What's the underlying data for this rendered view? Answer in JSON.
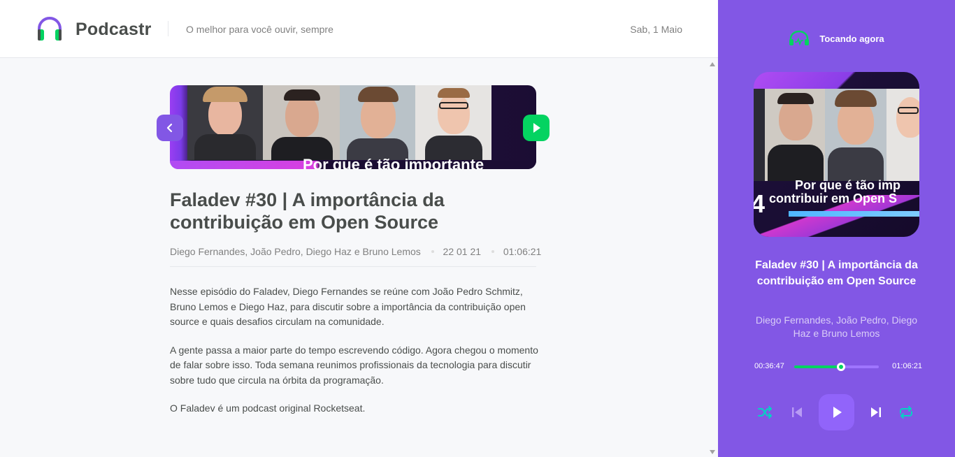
{
  "header": {
    "brand": "Podcastr",
    "tagline": "O melhor para você ouvir, sempre",
    "date": "Sab, 1 Maio"
  },
  "episode": {
    "thumbnail_caption": "Por que é tão importante",
    "title": "Faladev #30 | A importância da contribuição em Open Source",
    "members": "Diego Fernandes, João Pedro, Diego Haz e Bruno Lemos",
    "published_at": "22 01 21",
    "duration": "01:06:21",
    "description": [
      "Nesse episódio do Faladev, Diego Fernandes se reúne com João Pedro Schmitz, Bruno Lemos e Diego Haz, para discutir sobre a importância da contribuição open source e quais desafios circulam na comunidade.",
      "A gente passa a maior parte do tempo escrevendo código. Agora chegou o momento de falar sobre isso. Toda semana reunimos profissionais da tecnologia para discutir sobre tudo que circula na órbita da programação.",
      "O Faladev é um podcast original Rocketseat."
    ]
  },
  "player": {
    "label": "Tocando agora",
    "cover_caption_line1": "Por que é tão imp",
    "cover_caption_line2": "contribuir em Open S",
    "cover_number": "4",
    "title": "Faladev #30 | A importância da contribuição em Open Source",
    "members": "Diego Fernandes, João Pedro, Diego Haz e Bruno Lemos",
    "current_time": "00:36:47",
    "total_time": "01:06:21",
    "progress_fraction": 0.554
  },
  "colors": {
    "primary": "#8257e5",
    "green": "#04d361",
    "text": "#494d4b",
    "muted": "#808080"
  },
  "icons": {
    "logo": "headphones-icon",
    "prev": "chevron-left-icon",
    "play_episode": "play-icon",
    "now_playing": "headphones-icon",
    "shuffle": "shuffle-icon",
    "previous_track": "skip-back-icon",
    "play": "play-icon",
    "next_track": "skip-forward-icon",
    "repeat": "repeat-icon"
  }
}
